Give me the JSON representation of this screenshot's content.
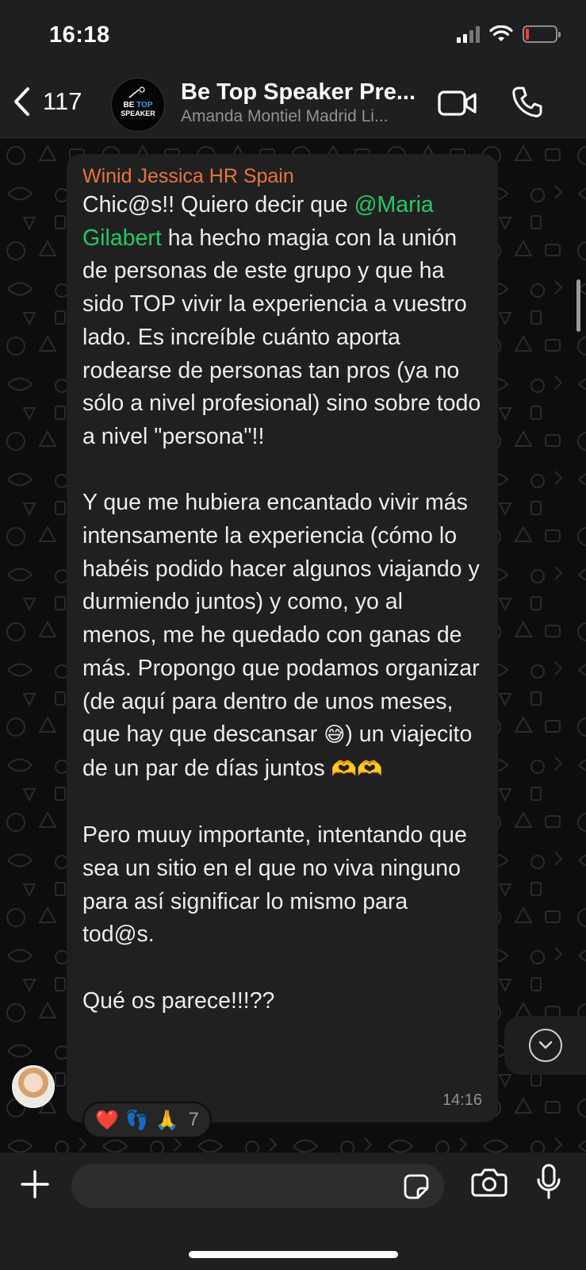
{
  "status_bar": {
    "time": "16:18"
  },
  "header": {
    "unread_count": "117",
    "avatar_line1_a": "BE",
    "avatar_line1_b": "TOP",
    "avatar_line2": "SPEAKER",
    "title": "Be Top Speaker Pre...",
    "subtitle": "Amanda Montiel Madrid Li..."
  },
  "message": {
    "sender": "Winid Jessica HR Spain",
    "p1_before_mention": "Chic@s!! Quiero decir que ",
    "mention": "@Maria Gilabert",
    "p1_after_mention": " ha hecho magia con la unión de personas de este grupo y que ha sido TOP vivir la experiencia a vuestro lado. Es increíble cuánto aporta rodearse de personas tan pros (ya no sólo a nivel profesional) sino sobre todo a nivel \"persona\"!!",
    "p2_a": "Y que me hubiera encantado vivir más intensamente la experiencia (cómo lo habéis podido hacer algunos viajando y durmiendo juntos) y como, yo al menos, me he quedado con ganas de más. Propongo que podamos organizar (de aquí para dentro de unos meses, que hay que descansar ",
    "p2_emoji": "😅",
    "p2_b": ") un viajecito de un par de días juntos ",
    "p2_emoji_end": "🫶🫶",
    "p3": "Pero muuy importante, intentando que sea un sitio en el que no viva ninguno para así significar lo mismo para tod@s.",
    "p4": "Qué os parece!!!??",
    "time": "14:16"
  },
  "reactions": {
    "items": [
      "❤️",
      "👣",
      "🙏"
    ],
    "count": "7"
  },
  "composer": {
    "placeholder": ""
  },
  "colors": {
    "sender": "#e8743b",
    "mention": "#25c864",
    "bubble": "#202020",
    "bar": "#1f1f1f"
  }
}
